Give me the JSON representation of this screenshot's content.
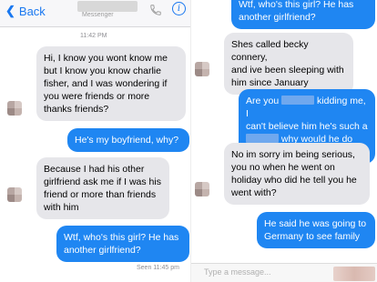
{
  "left_panel": {
    "navbar": {
      "back_label": "Back",
      "subtitle": "Messenger",
      "info_glyph": "i",
      "icons": [
        "chevron-left-icon",
        "phone-icon",
        "info-icon"
      ],
      "accent_color": "#1a78f0"
    },
    "timestamp": "11:42 PM",
    "messages": [
      {
        "side": "in",
        "text": "Hi, I know you wont know me\nbut I know you know charlie\nfisher, and I was wondering if\nyou were friends or more\nthanks friends?"
      },
      {
        "side": "out",
        "text": "He's my boyfriend, why?"
      },
      {
        "side": "in",
        "text": "Because I had his other\ngirlfriend ask me if I was his\nfriend or more than friends\nwith him"
      },
      {
        "side": "out",
        "text": "Wtf, who's this girl? He has\nanother girlfriend?"
      }
    ],
    "seen": "Seen 11:45 pm"
  },
  "right_panel": {
    "messages": [
      {
        "side": "out",
        "text": "Wtf, who's this girl? He has\nanother girlfriend?"
      },
      {
        "side": "in",
        "text": "Shes called becky connery,\nand ive been sleeping with\nhim since January"
      },
      {
        "side": "out",
        "text_a": "Are you",
        "text_b": " kidding me, I\ncan't believe him he's such a\n",
        "text_c": " why would he do this"
      },
      {
        "side": "in",
        "text": "No im sorry im being serious,\nyou no when he went on\nholiday who did he tell you he\nwent with?"
      },
      {
        "side": "out",
        "text": "He said he was going to\nGermany to see family"
      }
    ],
    "input_placeholder": "Type a message..."
  },
  "colors": {
    "incoming_bubble": "#e6e6ea",
    "outgoing_bubble": "#1f86f2"
  }
}
